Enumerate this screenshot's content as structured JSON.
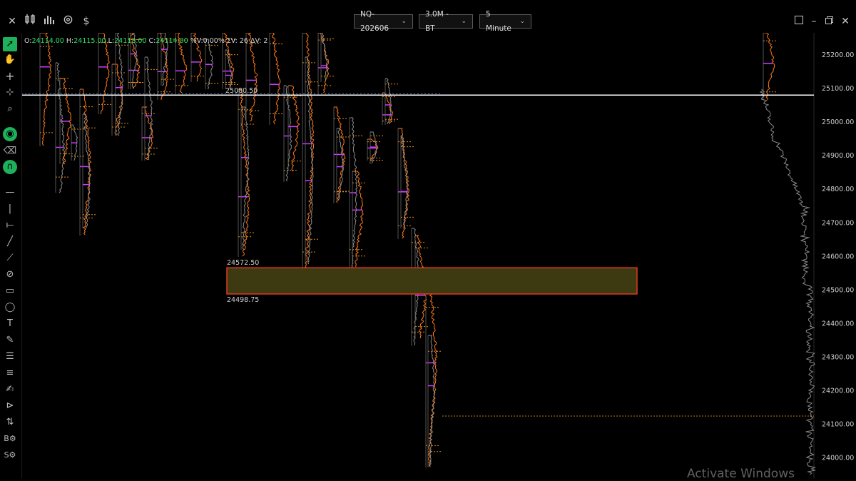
{
  "topbar": {
    "close_icon": "✕",
    "instrument": "NQ-202606",
    "chart_type": "3.0M - BT",
    "interval": "5 Minute"
  },
  "ohlc": {
    "o_label": "O:",
    "o_value": "24114.00",
    "h_label": "H:",
    "h_value": "24115.00",
    "l_label": "L:",
    "l_value": "24113.00",
    "c_label": "C:",
    "c_value": "24114.00",
    "pct": "%V:0.00%",
    "sumv": "ΣV: 26",
    "deltav": "ΔV: 2"
  },
  "price_axis": {
    "labels": [
      "25200.00",
      "25100.00",
      "25000.00",
      "24900.00",
      "24800.00",
      "24700.00",
      "24600.00",
      "24500.00",
      "24400.00",
      "24300.00",
      "24200.00",
      "24100.00",
      "24000.00"
    ]
  },
  "annotations": {
    "line_price": "25080.50",
    "box_top_price": "24572.50",
    "box_bottom_price": "24498.75"
  },
  "colors": {
    "accent_green": "#1db15b",
    "profile_orange": "#ff7a1a",
    "profile_gray": "#8c8c8c",
    "box_fill": "#3d3a12",
    "box_border": "#e03a1e",
    "poc_magenta": "#d23cff"
  },
  "watermark": "Activate Windows"
}
